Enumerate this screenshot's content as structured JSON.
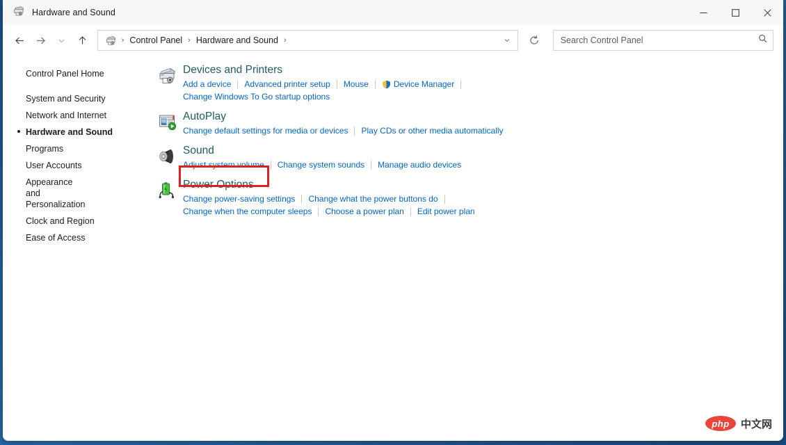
{
  "window": {
    "title": "Hardware and Sound",
    "title_icon": "devices-printers-icon",
    "minimize_label": "─",
    "maximize_label": "□",
    "close_label": "✕"
  },
  "toolbar": {
    "back_label": "Back",
    "forward_label": "Forward",
    "recent_label": "Recent locations",
    "up_label": "Up one level",
    "refresh_label": "Refresh",
    "address_dropdown_label": "Previous locations",
    "breadcrumbs": [
      {
        "label": "Control Panel"
      },
      {
        "label": "Hardware and Sound"
      }
    ],
    "breadcrumb_separator": "›"
  },
  "search": {
    "placeholder": "Search Control Panel",
    "value": "",
    "icon": "search-icon"
  },
  "sidebar": {
    "home": "Control Panel Home",
    "items": [
      {
        "label": "System and Security",
        "current": false
      },
      {
        "label": "Network and Internet",
        "current": false
      },
      {
        "label": "Hardware and Sound",
        "current": true
      },
      {
        "label": "Programs",
        "current": false
      },
      {
        "label": "User Accounts",
        "current": false
      },
      {
        "label": "Appearance and Personalization",
        "current": false
      },
      {
        "label": "Clock and Region",
        "current": false
      },
      {
        "label": "Ease of Access",
        "current": false
      }
    ]
  },
  "main": {
    "categories": [
      {
        "title": "Devices and Printers",
        "icon": "printer-icon",
        "rows": [
          [
            {
              "label": "Add a device",
              "shield": false
            },
            {
              "label": "Advanced printer setup",
              "shield": false
            },
            {
              "label": "Mouse",
              "shield": false
            },
            {
              "label": "Device Manager",
              "shield": true
            }
          ],
          [
            {
              "label": "Change Windows To Go startup options",
              "shield": false
            }
          ]
        ]
      },
      {
        "title": "AutoPlay",
        "icon": "autoplay-icon",
        "rows": [
          [
            {
              "label": "Change default settings for media or devices",
              "shield": false
            },
            {
              "label": "Play CDs or other media automatically",
              "shield": false
            }
          ]
        ]
      },
      {
        "title": "Sound",
        "icon": "speaker-icon",
        "rows": [
          [
            {
              "label": "Adjust system volume",
              "shield": false
            },
            {
              "label": "Change system sounds",
              "shield": false
            },
            {
              "label": "Manage audio devices",
              "shield": false
            }
          ]
        ]
      },
      {
        "title": "Power Options",
        "icon": "battery-plug-icon",
        "highlighted": true,
        "rows": [
          [
            {
              "label": "Change power-saving settings",
              "shield": false
            },
            {
              "label": "Change what the power buttons do",
              "shield": false
            }
          ],
          [
            {
              "label": "Change when the computer sleeps",
              "shield": false
            },
            {
              "label": "Choose a power plan",
              "shield": false
            },
            {
              "label": "Edit power plan",
              "shield": false
            }
          ]
        ]
      }
    ]
  },
  "annotation": {
    "highlight_color": "#e02020",
    "target": "Power Options"
  },
  "watermark": {
    "badge_text": "php",
    "text": "中文网",
    "badge_color": "#e8453c"
  },
  "theme": {
    "heading_color": "#1f5c5c",
    "link_color": "#0066cc",
    "window_background": "#ffffff",
    "titlebar_background": "#f7f7f7",
    "desktop_background": "#1f4f86"
  }
}
